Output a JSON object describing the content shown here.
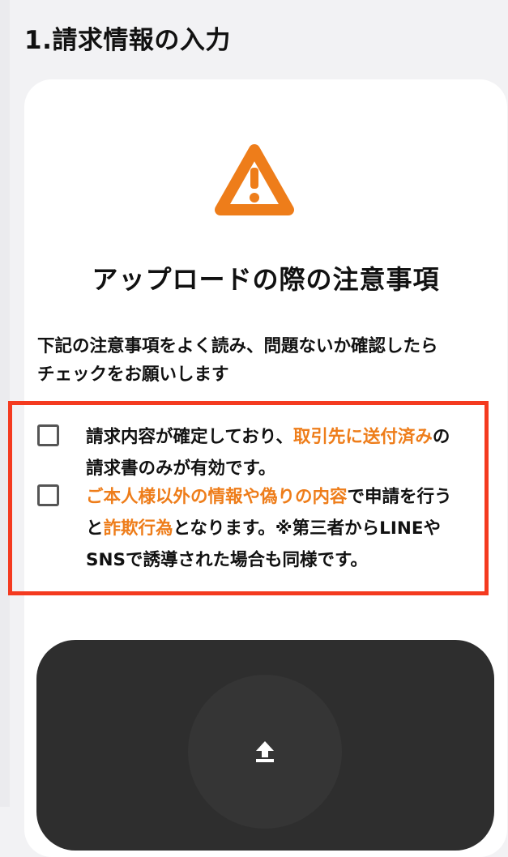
{
  "section": {
    "title": "1.請求情報の入力"
  },
  "notice": {
    "icon": "warning-triangle-icon",
    "heading": "アップロードの際の注意事項",
    "intro_line1": "下記の注意事項をよく読み、問題ないか確認したら",
    "intro_line2": "チェックをお願いします"
  },
  "checks": [
    {
      "checked": false,
      "p1": "請求内容が確定しており、",
      "h1": "取引先に送付済み",
      "p2": "の",
      "p3": "請求書のみが有効です。"
    },
    {
      "checked": false,
      "h1": "ご本人様以外の情報や偽りの内容",
      "p1": "で申請を行う",
      "p2": "と",
      "h2": "詐欺行為",
      "p3": "となります。※第三者からLINEや",
      "p4": "SNSで誘導された場合も同様です。"
    }
  ],
  "upload": {
    "icon": "upload-arrow-icon"
  },
  "colors": {
    "accent_orange": "#ee7d1a",
    "highlight_red": "#f43a1f",
    "upload_background": "#2e2e2e"
  }
}
